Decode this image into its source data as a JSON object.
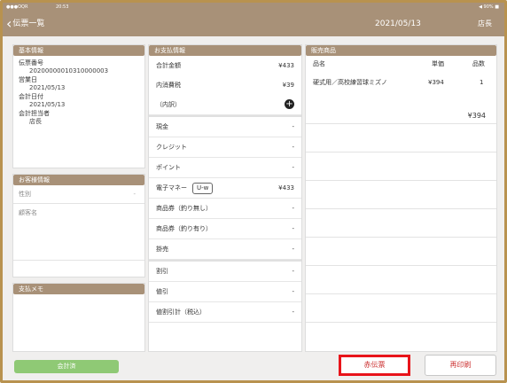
{
  "statusbar": {
    "left": "●●●OQR",
    "center": "20:53",
    "right": "◀ 90% ■"
  },
  "navbar": {
    "back_label": "伝票一覧",
    "date": "2021/05/13",
    "user": "店長"
  },
  "basic_info": {
    "header": "基本情報",
    "fields": [
      {
        "label": "伝票番号",
        "value": "20200000010310000003"
      },
      {
        "label": "営業日",
        "value": "2021/05/13"
      },
      {
        "label": "会計日付",
        "value": "2021/05/13"
      },
      {
        "label": "会計担当者",
        "value": "店長"
      }
    ]
  },
  "customer_info": {
    "header": "お客様情報",
    "gender_label": "性別",
    "gender_value": "-",
    "name_label": "顧客名"
  },
  "payment_memo": {
    "header": "支払メモ"
  },
  "payment_info": {
    "header": "お支払情報",
    "total_label": "合計金額",
    "total_value": "¥433",
    "tax_label": "内消費税",
    "tax_value": "¥39",
    "breakdown_label": "（内訳）",
    "cash_label": "現金",
    "cash_value": "-",
    "credit_label": "クレジット",
    "credit_value": "-",
    "point_label": "ポイント",
    "point_value": "-",
    "emoney_label": "電子マネー",
    "emoney_badge": "U-w",
    "emoney_value": "¥433",
    "voucher_nochange_label": "商品券（釣り無し）",
    "voucher_nochange_value": "-",
    "voucher_change_label": "商品券（釣り有り）",
    "voucher_change_value": "-",
    "misc_label": "掛売",
    "misc_value": "-",
    "discount_label": "割引",
    "discount_value": "-",
    "reduction_label": "値引",
    "reduction_value": "-",
    "reduction_total_label": "値割引計（税込）",
    "reduction_total_value": "-"
  },
  "sales_items": {
    "header": "販売商品",
    "columns": {
      "name": "品名",
      "price": "単価",
      "qty": "品数"
    },
    "rows": [
      {
        "name": "硬式用／高校練習球ミズノ",
        "price": "¥394",
        "qty": "1"
      }
    ],
    "subtotal": "¥394"
  },
  "footer": {
    "settled_label": "会計済",
    "red_slip_label": "赤伝票",
    "reprint_label": "再印刷"
  },
  "colors": {
    "header_bg": "#a89178",
    "accent_red": "#e8141a",
    "settled_green": "#8fc975"
  }
}
